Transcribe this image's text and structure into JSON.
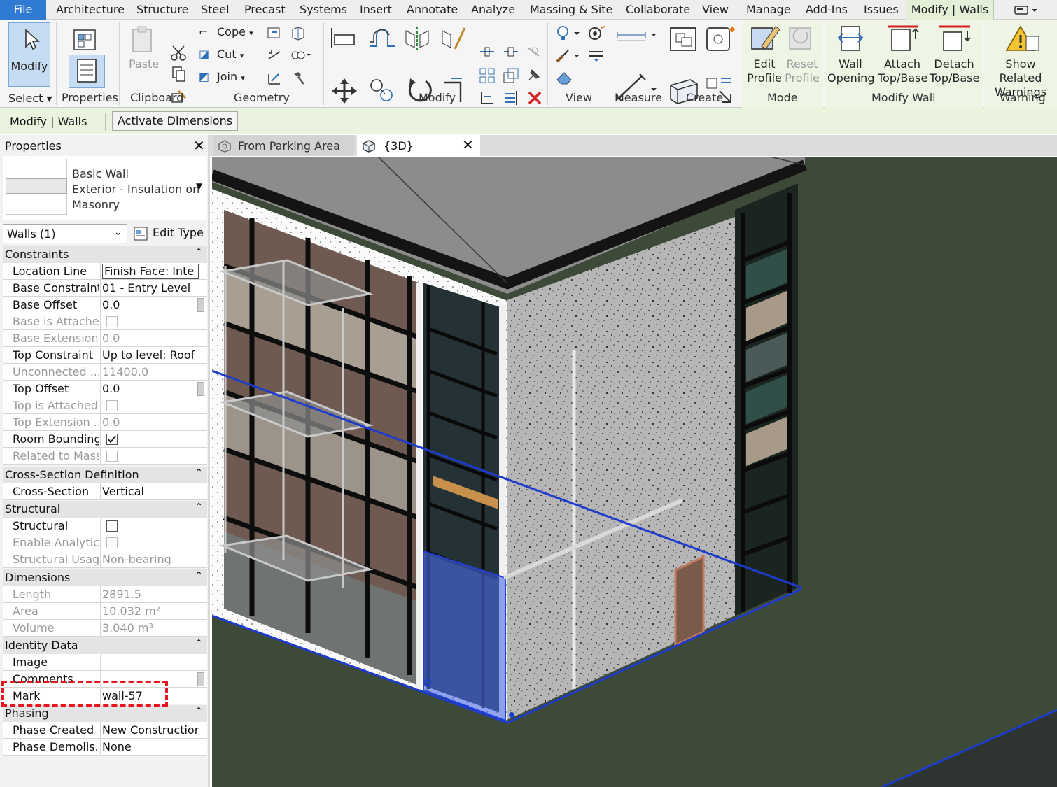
{
  "menu": {
    "file": "File",
    "tabs": [
      "Architecture",
      "Structure",
      "Steel",
      "Precast",
      "Systems",
      "Insert",
      "Annotate",
      "Analyze",
      "Massing & Site",
      "Collaborate",
      "View",
      "Manage",
      "Add-Ins",
      "Issues"
    ],
    "active_tab": "Modify | Walls"
  },
  "ribbon": {
    "select": {
      "modify": "Modify",
      "label": "Select"
    },
    "properties": {
      "label": "Properties"
    },
    "clipboard": {
      "paste": "Paste",
      "label": "Clipboard"
    },
    "geometry": {
      "cope": "Cope",
      "cut": "Cut",
      "join": "Join",
      "label": "Geometry"
    },
    "modify": {
      "label": "Modify"
    },
    "view": {
      "label": "View"
    },
    "measure": {
      "label": "Measure"
    },
    "create": {
      "label": "Create"
    },
    "mode": {
      "edit_profile": [
        "Edit",
        "Profile"
      ],
      "reset_profile": [
        "Reset",
        "Profile"
      ],
      "label": "Mode"
    },
    "modify_wall": {
      "wall_opening": [
        "Wall",
        "Opening"
      ],
      "attach": [
        "Attach",
        "Top/Base"
      ],
      "detach": [
        "Detach",
        "Top/Base"
      ],
      "label": "Modify Wall"
    },
    "warning": {
      "show_related": [
        "Show Related",
        "Warnings"
      ],
      "label": "Warning"
    }
  },
  "options_bar": {
    "context": "Modify | Walls",
    "activate_dimensions": "Activate Dimensions"
  },
  "properties": {
    "title": "Properties",
    "type_lines": [
      "Basic Wall",
      "Exterior - Insulation on",
      "Masonry"
    ],
    "selector": "Walls (1)",
    "edit_type": "Edit Type",
    "sections": {
      "constraints": "Constraints",
      "cross_section": "Cross-Section Definition",
      "structural": "Structural",
      "dimensions": "Dimensions",
      "identity": "Identity Data",
      "phasing": "Phasing"
    },
    "rows": {
      "location_line": [
        "Location Line",
        "Finish Face: Inte"
      ],
      "base_constraint": [
        "Base Constraint",
        "01 - Entry Level"
      ],
      "base_offset": [
        "Base Offset",
        "0.0"
      ],
      "base_attached": [
        "Base is Attached",
        ""
      ],
      "base_extension": [
        "Base Extension...",
        "0.0"
      ],
      "top_constraint": [
        "Top Constraint",
        "Up to level: Roof"
      ],
      "unconnected": [
        "Unconnected ...",
        "11400.0"
      ],
      "top_offset": [
        "Top Offset",
        "0.0"
      ],
      "top_attached": [
        "Top is Attached",
        ""
      ],
      "top_extension": [
        "Top Extension ...",
        "0.0"
      ],
      "room_bounding": [
        "Room Bounding",
        ""
      ],
      "related_mass": [
        "Related to Mass",
        ""
      ],
      "cross_section": [
        "Cross-Section",
        "Vertical"
      ],
      "structural": [
        "Structural",
        ""
      ],
      "enable_analytic": [
        "Enable Analytic...",
        ""
      ],
      "structural_usage": [
        "Structural Usage",
        "Non-bearing"
      ],
      "length": [
        "Length",
        "2891.5"
      ],
      "area": [
        "Area",
        "10.032 m²"
      ],
      "volume": [
        "Volume",
        "3.040 m³"
      ],
      "image": [
        "Image",
        ""
      ],
      "comments": [
        "Comments",
        ""
      ],
      "mark": [
        "Mark",
        "wall-57"
      ],
      "phase_created": [
        "Phase Created",
        "New Construction"
      ],
      "phase_demolished": [
        "Phase Demolis...",
        "None"
      ]
    }
  },
  "view_tabs": [
    "From Parking Area",
    "{3D}"
  ],
  "colors": {
    "file_blue": "#2f7ad2",
    "context_green": "#e9f3dd",
    "highlight_red": "#e8141e",
    "selection_blue": "#1e3ccc"
  }
}
